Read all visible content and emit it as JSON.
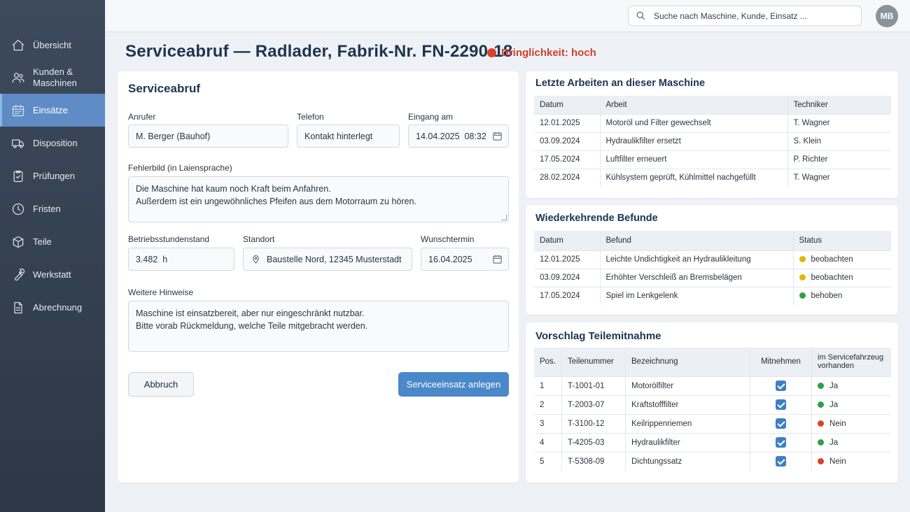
{
  "sidebar": {
    "items": [
      {
        "label": "Übersicht",
        "icon": "home-icon"
      },
      {
        "label": "Kunden & Maschinen",
        "icon": "users-icon"
      },
      {
        "label": "Einsätze",
        "icon": "calendar-icon",
        "active": true
      },
      {
        "label": "Disposition",
        "icon": "truck-icon"
      },
      {
        "label": "Prüfungen",
        "icon": "clipboard-check-icon"
      },
      {
        "label": "Fristen",
        "icon": "clock-icon"
      },
      {
        "label": "Teile",
        "icon": "box-icon"
      },
      {
        "label": "Werkstatt",
        "icon": "wrench-icon"
      },
      {
        "label": "Abrechnung",
        "icon": "document-icon"
      }
    ]
  },
  "topbar": {
    "search_placeholder": "Suche nach Maschine, Kunde, Einsatz ...",
    "avatar_initials": "MB"
  },
  "header": {
    "title": "Serviceabruf — Radlader, Fabrik-Nr. FN-2290-18",
    "urgency": "Dringlichkeit: hoch",
    "urgency_color": "#d9412a"
  },
  "form": {
    "title": "Serviceabruf",
    "caller_label": "Anrufer",
    "caller_value": "M. Berger (Bauhof)",
    "phone_label": "Telefon",
    "phone_value": "Kontakt hinterlegt",
    "received_label": "Eingang am",
    "received_value": "14.04.2025  08:32",
    "fault_label": "Fehlerbild (in Laiensprache)",
    "fault_lines": [
      "Die Maschine hat kaum noch Kraft beim Anfahren.",
      "Außerdem ist ein ungewöhnliches Pfeifen aus dem Motorraum zu hören."
    ],
    "hours_label": "Betriebsstundenstand",
    "hours_value": "3.482  h",
    "location_label": "Standort",
    "location_value": "Baustelle Nord, 12345 Musterstadt",
    "desired_label": "Wunschtermin",
    "desired_value": "16.04.2025",
    "notes_label": "Weitere Hinweise",
    "notes_lines": [
      "Maschine ist einsatzbereit, aber nur eingeschränkt nutzbar.",
      "Bitte vorab Rückmeldung, welche Teile mitgebracht werden."
    ],
    "cancel_label": "Abbruch",
    "submit_label": "Serviceeinsatz anlegen",
    "primary_color": "#4a88c9"
  },
  "recent_work": {
    "title": "Letzte Arbeiten an dieser Maschine",
    "headers": [
      "Datum",
      "Arbeit",
      "Techniker"
    ],
    "rows": [
      [
        "12.01.2025",
        "Motoröl und Filter gewechselt",
        "T. Wagner"
      ],
      [
        "03.09.2024",
        "Hydraulikfilter ersetzt",
        "S. Klein"
      ],
      [
        "17.05.2024",
        "Luftfilter erneuert",
        "P. Richter"
      ],
      [
        "28.02.2024",
        "Kühlsystem geprüft, Kühlmittel nachgefüllt",
        "T. Wagner"
      ]
    ]
  },
  "findings": {
    "title": "Wiederkehrende Befunde",
    "headers": [
      "Datum",
      "Befund",
      "Status"
    ],
    "rows": [
      {
        "date": "12.01.2025",
        "finding": "Leichte Undichtigkeit an Hydraulikleitung",
        "status": "beobachten",
        "color": "#e8b400"
      },
      {
        "date": "03.09.2024",
        "finding": "Erhöhter Verschleiß an Bremsbelägen",
        "status": "beobachten",
        "color": "#e8b400"
      },
      {
        "date": "17.05.2024",
        "finding": "Spiel im Lenkgelenk",
        "status": "behoben",
        "color": "#2ea043"
      }
    ]
  },
  "parts": {
    "title": "Vorschlag Teilemitnahme",
    "headers": [
      "Pos.",
      "Teilenummer",
      "Bezeichnung",
      "Mitnehmen",
      "im Servicefahrzeug vorhanden"
    ],
    "rows": [
      {
        "pos": "1",
        "number": "T-1001-01",
        "name": "Motorölfilter",
        "take": true,
        "available": "Ja",
        "color": "#2ea043"
      },
      {
        "pos": "2",
        "number": "T-2003-07",
        "name": "Kraftstofffilter",
        "take": true,
        "available": "Ja",
        "color": "#2ea043"
      },
      {
        "pos": "3",
        "number": "T-3100-12",
        "name": "Keilrippenriemen",
        "take": true,
        "available": "Nein",
        "color": "#d9412a"
      },
      {
        "pos": "4",
        "number": "T-4205-03",
        "name": "Hydraulikfilter",
        "take": true,
        "available": "Ja",
        "color": "#2ea043"
      },
      {
        "pos": "5",
        "number": "T-5308-09",
        "name": "Dichtungssatz",
        "take": true,
        "available": "Nein",
        "color": "#d9412a"
      }
    ]
  }
}
